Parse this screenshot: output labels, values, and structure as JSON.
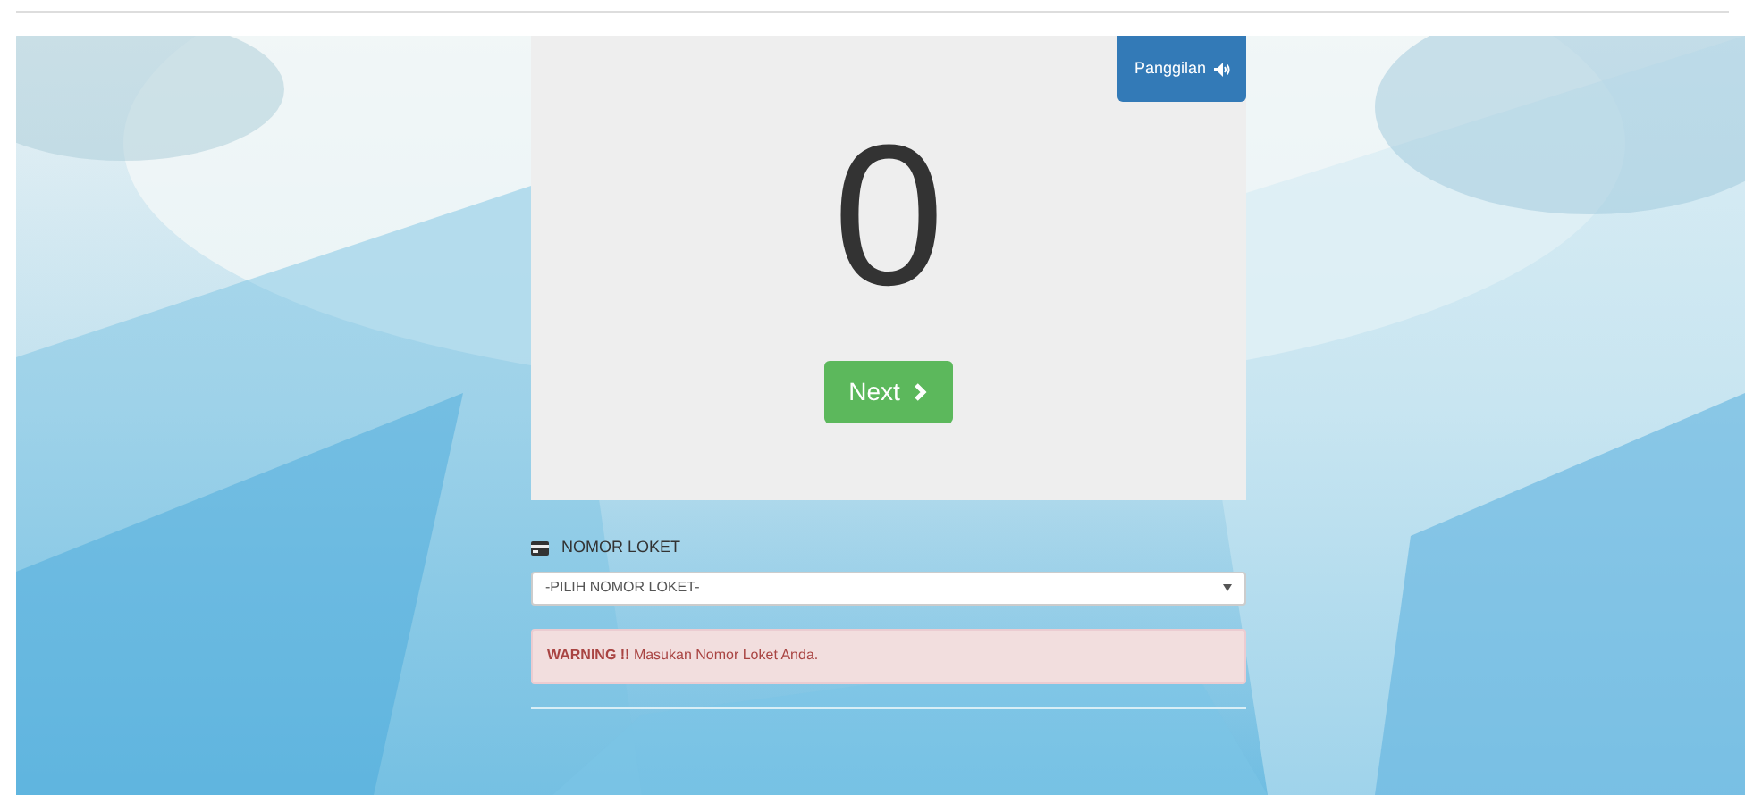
{
  "call_button": {
    "label": "Panggilan"
  },
  "counter": "0",
  "next_button": {
    "label": "Next"
  },
  "counter_field": {
    "label": "NOMOR LOKET",
    "value": "-PILIH NOMOR LOKET-"
  },
  "alert": {
    "text": "**WARNING !!** Masukan Nomor Loket Anda."
  }
}
